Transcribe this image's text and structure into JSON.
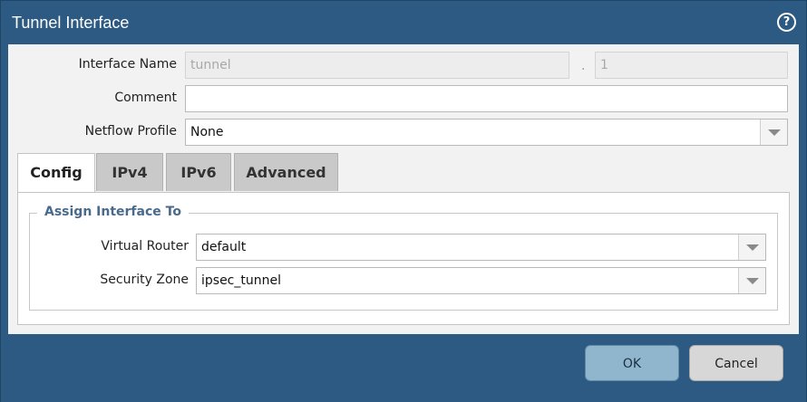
{
  "dialog": {
    "title": "Tunnel Interface",
    "help_glyph": "?"
  },
  "form": {
    "interface_name_label": "Interface Name",
    "interface_name_value": "tunnel",
    "interface_sep": ".",
    "interface_unit": "1",
    "comment_label": "Comment",
    "comment_value": "",
    "netflow_label": "Netflow Profile",
    "netflow_value": "None"
  },
  "tabs": [
    {
      "label": "Config",
      "active": true
    },
    {
      "label": "IPv4",
      "active": false
    },
    {
      "label": "IPv6",
      "active": false
    },
    {
      "label": "Advanced",
      "active": false
    }
  ],
  "assign": {
    "legend": "Assign Interface To",
    "virtual_router_label": "Virtual Router",
    "virtual_router_value": "default",
    "security_zone_label": "Security Zone",
    "security_zone_value": "ipsec_tunnel"
  },
  "footer": {
    "ok_label": "OK",
    "cancel_label": "Cancel"
  },
  "icons": {
    "help": "help-circle-icon",
    "dropdown": "chevron-down-icon"
  },
  "colors": {
    "frame": "#2c5a82",
    "body": "#f2f2f2",
    "ok_button": "#8fb6cd",
    "cancel_button": "#d7d7d7",
    "legend_text": "#4a6a8c"
  }
}
